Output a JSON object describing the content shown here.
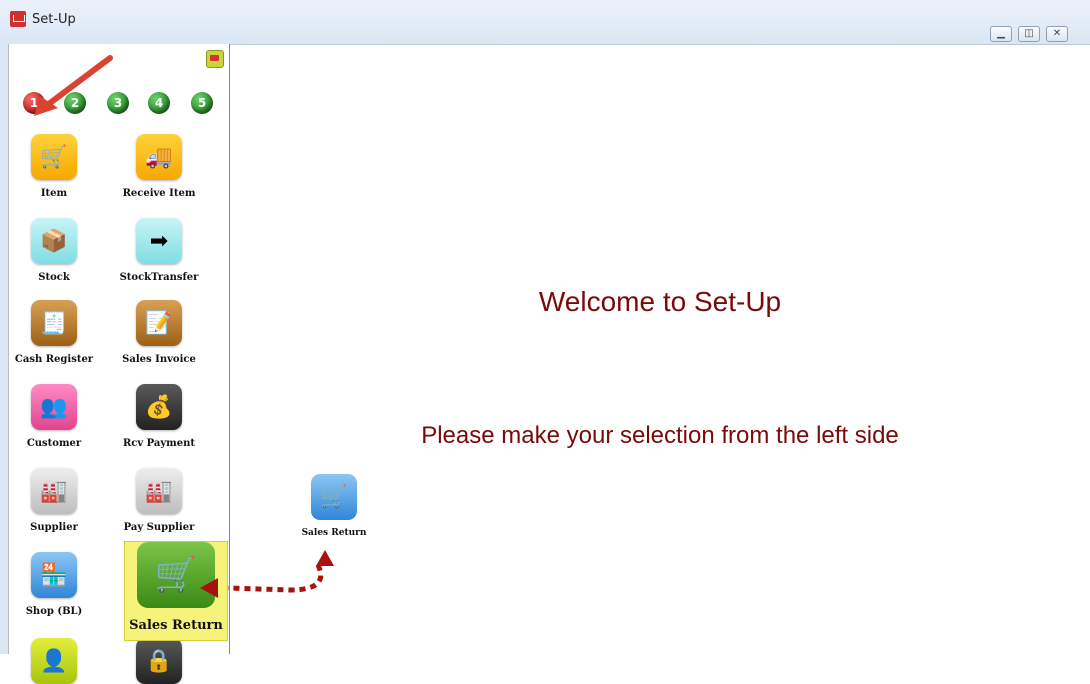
{
  "window": {
    "title": "Set-Up",
    "controls": [
      "minimize",
      "restore",
      "close"
    ]
  },
  "sidebar": {
    "pages": [
      {
        "label": "1",
        "color": "#c00000",
        "active": true
      },
      {
        "label": "2",
        "color": "#1b7f1b",
        "active": false
      },
      {
        "label": "3",
        "color": "#1b7f1b",
        "active": false
      },
      {
        "label": "4",
        "color": "#1b7f1b",
        "active": false
      },
      {
        "label": "5",
        "color": "#1b7f1b",
        "active": false
      }
    ],
    "tiles": [
      {
        "label": "Item",
        "icon": "shopping-cart-icon"
      },
      {
        "label": "Receive Item",
        "icon": "truck-icon"
      },
      {
        "label": "Stock",
        "icon": "hand-truck-icon"
      },
      {
        "label": "StockTransfer",
        "icon": "box-transfer-icon"
      },
      {
        "label": "Cash Register",
        "icon": "cash-register-icon"
      },
      {
        "label": "Sales Invoice",
        "icon": "invoice-pen-icon"
      },
      {
        "label": "Customer",
        "icon": "customers-icon"
      },
      {
        "label": "Rcv Payment",
        "icon": "coin-stack-icon"
      },
      {
        "label": "Supplier",
        "icon": "factory-icon"
      },
      {
        "label": "Pay Supplier",
        "icon": "factory-arrow-icon"
      },
      {
        "label": "Shop (BL)",
        "icon": "shop-icon"
      },
      {
        "label": "Sales Return",
        "icon": "cart-return-icon"
      }
    ]
  },
  "main": {
    "welcome": "Welcome to Set-Up",
    "instruction": "Please make your selection from the left side"
  },
  "annotation": {
    "floating_tile_label": "Sales Return",
    "highlight_color": "#f6f27a",
    "arrow_color": "#c0392b"
  }
}
